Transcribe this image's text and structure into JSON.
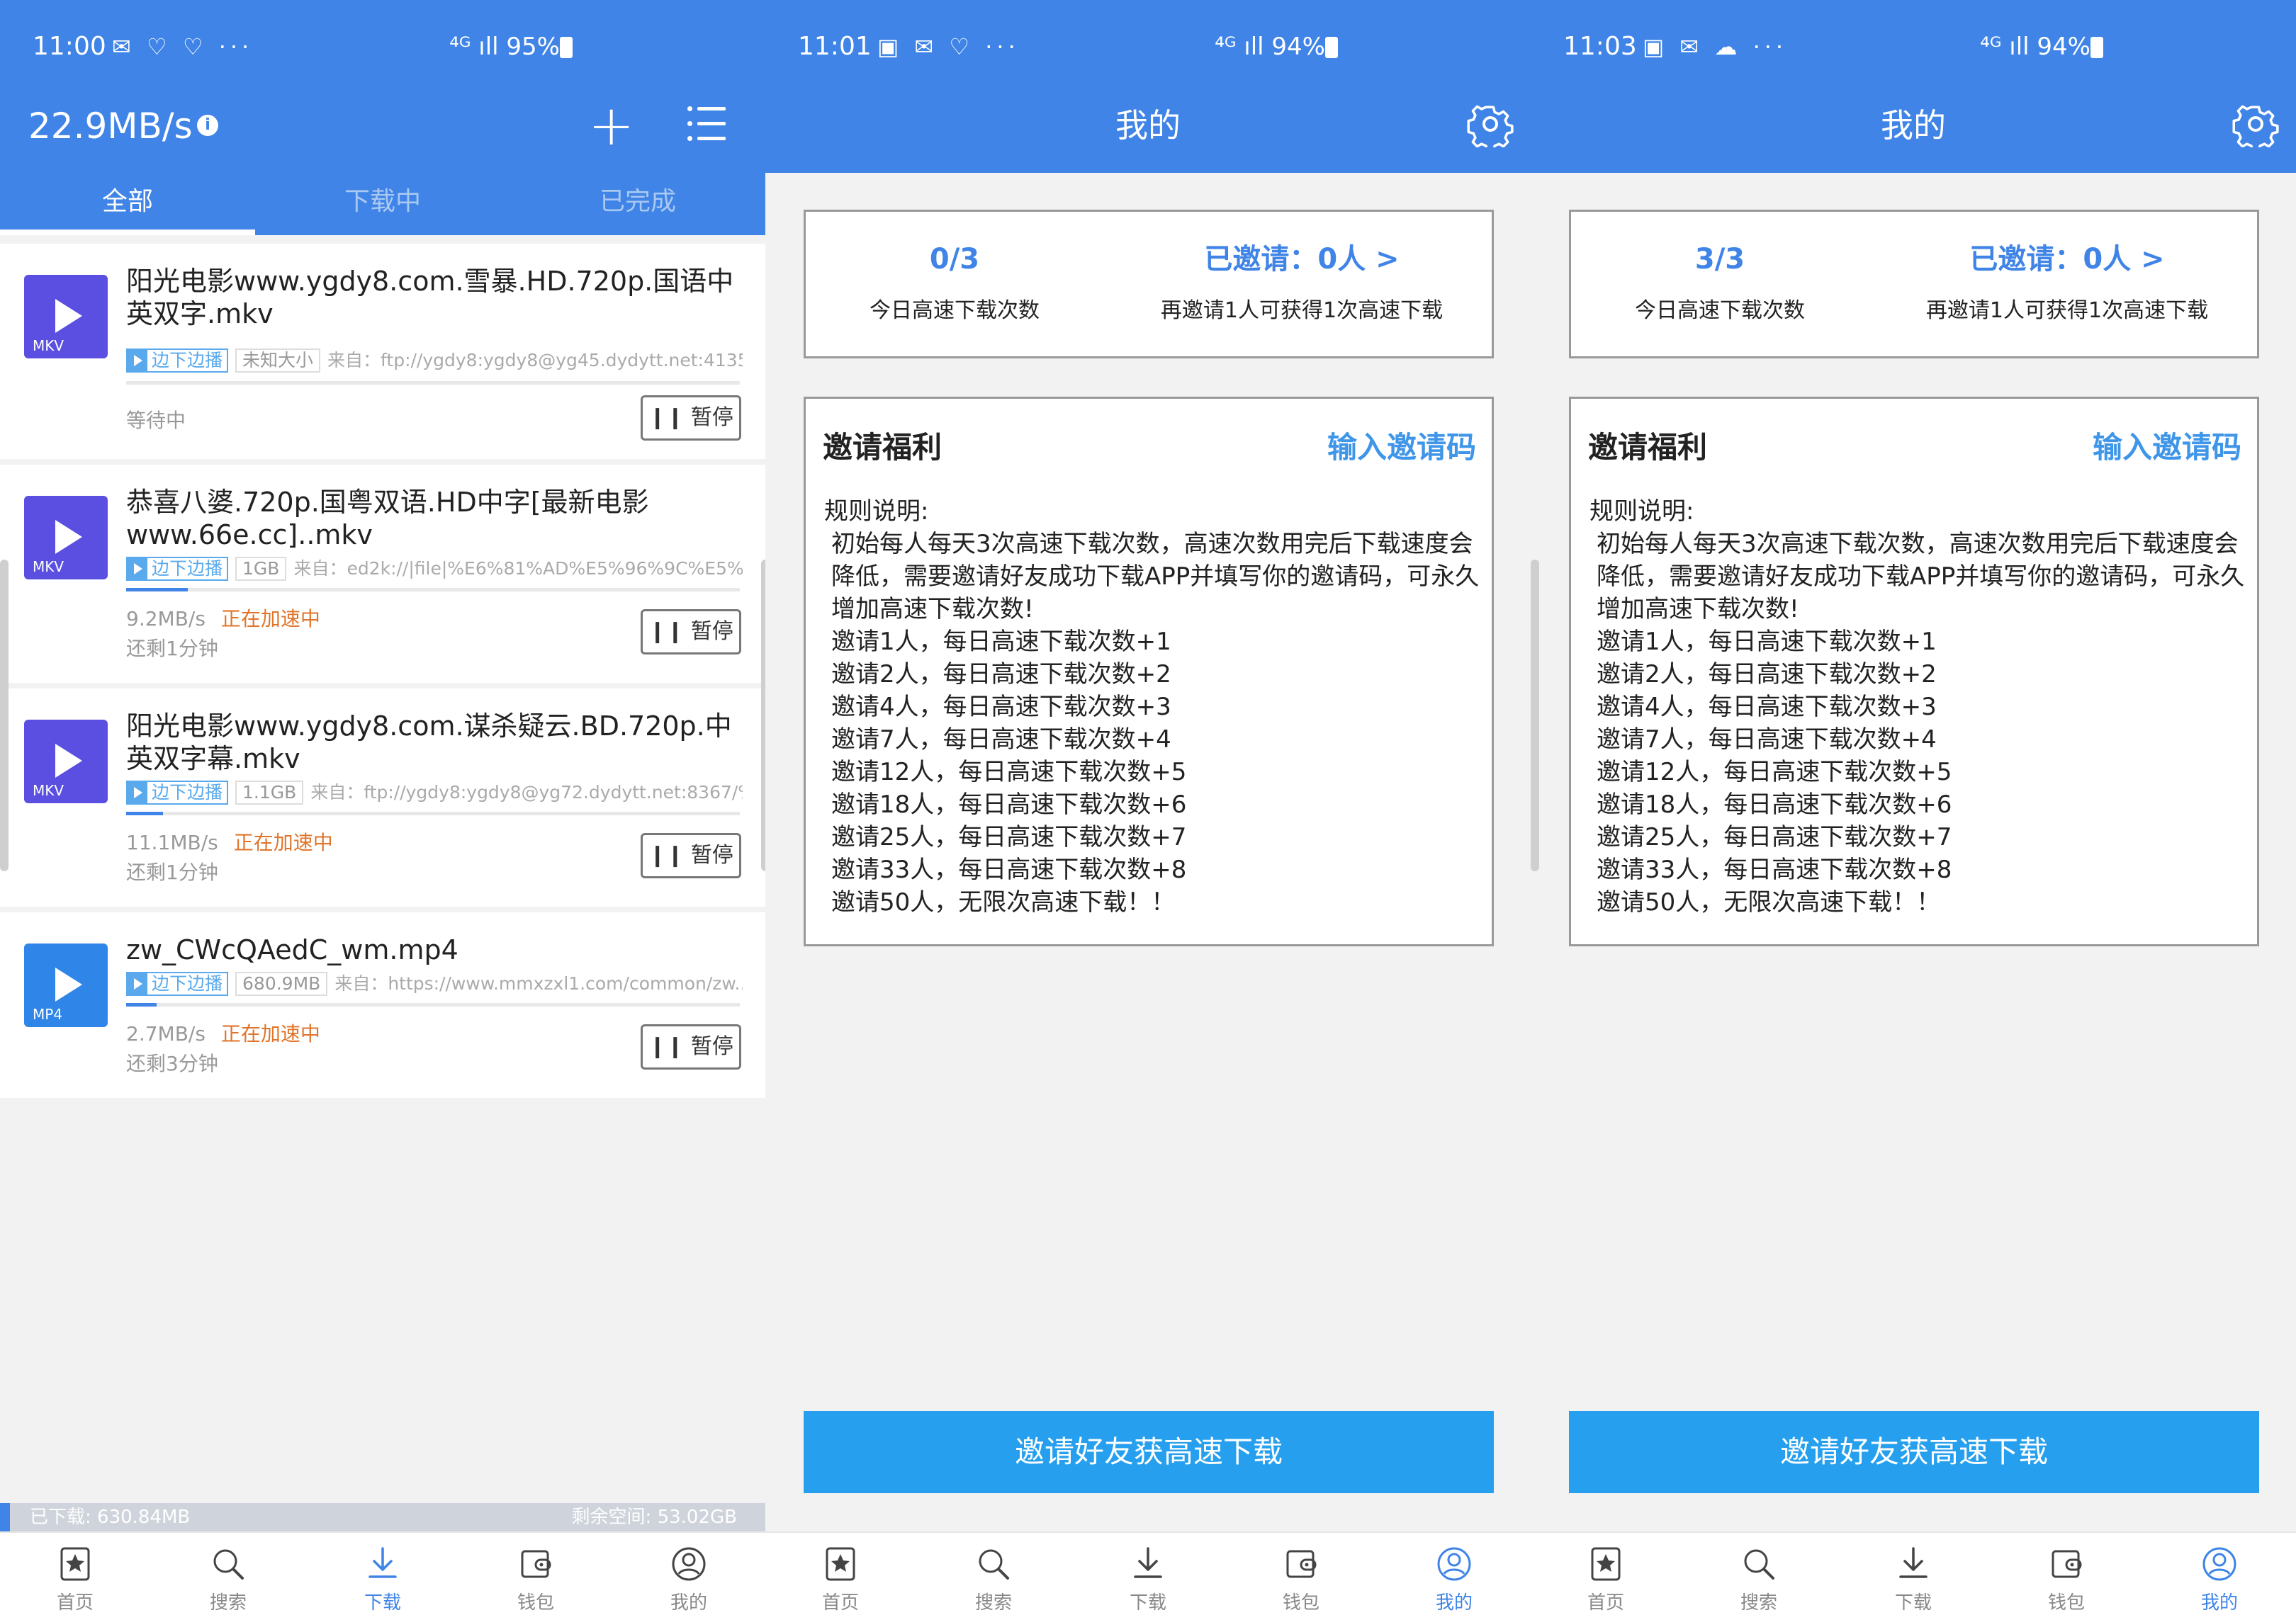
{
  "panel1": {
    "status": {
      "time": "11:00",
      "icons": "✉ ♡ ♡ ···",
      "signal": "⁴ᴳ ıll 95%"
    },
    "speed": "22.9MB/s",
    "tabs": [
      "全部",
      "下载中",
      "已完成"
    ],
    "items": [
      {
        "name": "阳光电影www.ygdy8.com.雪暴.HD.720p.国语中英双字.mkv",
        "ext": "MKV",
        "play_tag": "边下边播",
        "size": "未知大小",
        "source": "来自：ftp://ygdy8:ygdy8@yg45.dydytt.net:4135/...",
        "status": "等待中",
        "speed": "",
        "remain": "",
        "pause": "暂停",
        "progress": 0
      },
      {
        "name": "恭喜八婆.720p.国粤双语.HD中字[最新电影www.66e.cc]..mkv",
        "ext": "MKV",
        "play_tag": "边下边播",
        "size": "1GB",
        "source": "来自：ed2k://|file|%E6%81%AD%E5%96%9C%E5%85...",
        "status": "",
        "speed": "9.2MB/s",
        "accel": "正在加速中",
        "remain": "还剩1分钟",
        "pause": "暂停",
        "progress": 0.1
      },
      {
        "name": "阳光电影www.ygdy8.com.谋杀疑云.BD.720p.中英双字幕.mkv",
        "ext": "MKV",
        "play_tag": "边下边播",
        "size": "1.1GB",
        "source": "来自：ftp://ygdy8:ygdy8@yg72.dydytt.net:8367/%...",
        "status": "",
        "speed": "11.1MB/s",
        "accel": "正在加速中",
        "remain": "还剩1分钟",
        "pause": "暂停",
        "progress": 0.06
      },
      {
        "name": "zw_CWcQAedC_wm.mp4",
        "ext": "MP4",
        "play_tag": "边下边播",
        "size": "680.9MB",
        "source": "来自：https://www.mmxzxl1.com/common/zw...",
        "status": "",
        "speed": "2.7MB/s",
        "accel": "正在加速中",
        "remain": "还剩3分钟",
        "pause": "暂停",
        "progress": 0.05
      }
    ],
    "bottom": {
      "downloaded": "已下载: 630.84MB",
      "free": "剩余空间: 53.02GB"
    }
  },
  "nav": [
    "首页",
    "搜索",
    "下载",
    "钱包",
    "我的"
  ],
  "panel2": {
    "status": {
      "time": "11:01",
      "icons": "▣ ✉ ♡ ···",
      "signal": "⁴ᴳ ıll 94%"
    },
    "title": "我的",
    "quota": "0/3",
    "quota_label": "今日高速下载次数",
    "invited": "已邀请：0人 >",
    "invite_hint": "再邀请1人可获得1次高速下载"
  },
  "panel3": {
    "status": {
      "time": "11:03",
      "icons": "▣ ✉ ☁ ···",
      "signal": "⁴ᴳ ıll 94%"
    },
    "title": "我的",
    "quota": "3/3",
    "quota_label": "今日高速下载次数",
    "invited": "已邀请：0人 >",
    "invite_hint": "再邀请1人可获得1次高速下载"
  },
  "rules": {
    "title": "邀请福利",
    "link": "输入邀请码",
    "heading": "规则说明:",
    "intro": "初始每人每天3次高速下载次数，高速次数用完后下载速度会降低，需要邀请好友成功下载APP并填写你的邀请码，可永久增加高速下载次数!",
    "lines": [
      "邀请1人，每日高速下载次数+1",
      "邀请2人，每日高速下载次数+2",
      "邀请4人，每日高速下载次数+3",
      "邀请7人，每日高速下载次数+4",
      "邀请12人，每日高速下载次数+5",
      "邀请18人，每日高速下载次数+6",
      "邀请25人，每日高速下载次数+7",
      "邀请33人，每日高速下载次数+8",
      "邀请50人，无限次高速下载！！"
    ]
  },
  "invite_button": "邀请好友获高速下载",
  "colors": {
    "primary": "#3f84e6",
    "accent": "#26a0ee",
    "accel": "#e0742a"
  }
}
